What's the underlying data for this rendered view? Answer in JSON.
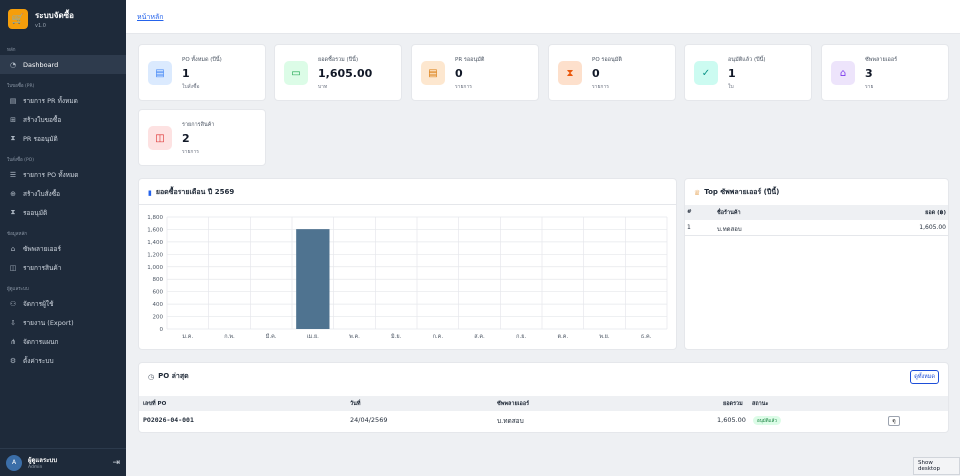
{
  "app": {
    "title": "ระบบจัดซื้อ",
    "version": "v1.0"
  },
  "sidebar": {
    "sections": [
      {
        "label": "หลัก",
        "items": [
          {
            "label": "Dashboard",
            "icon": "dashboard-icon"
          }
        ]
      },
      {
        "label": "ใบขอซื้อ (PR)",
        "items": [
          {
            "label": "รายการ PR ทั้งหมด",
            "icon": "document-icon"
          },
          {
            "label": "สร้างใบขอซื้อ",
            "icon": "plus-square-icon"
          },
          {
            "label": "PR รออนุมัติ",
            "icon": "hourglass-icon"
          }
        ]
      },
      {
        "label": "ใบสั่งซื้อ (PO)",
        "items": [
          {
            "label": "รายการ PO ทั้งหมด",
            "icon": "list-icon"
          },
          {
            "label": "สร้างใบสั่งซื้อ",
            "icon": "plus-circle-icon"
          },
          {
            "label": "รออนุมัติ",
            "icon": "hourglass-icon"
          }
        ]
      },
      {
        "label": "ข้อมูลหลัก",
        "items": [
          {
            "label": "ซัพพลายเออร์",
            "icon": "store-icon"
          },
          {
            "label": "รายการสินค้า",
            "icon": "box-icon"
          }
        ]
      },
      {
        "label": "ผู้ดูแลระบบ",
        "items": [
          {
            "label": "จัดการผู้ใช้",
            "icon": "users-icon"
          },
          {
            "label": "รายงาน (Export)",
            "icon": "download-icon"
          },
          {
            "label": "จัดการแผนก",
            "icon": "sitemap-icon"
          },
          {
            "label": "ตั้งค่าระบบ",
            "icon": "gear-icon"
          }
        ]
      }
    ],
    "user": {
      "initial": "A",
      "name": "ผู้ดูแลระบบ",
      "role": "Admin"
    }
  },
  "breadcrumb": {
    "home": "หน้าหลัก"
  },
  "stats": [
    {
      "label": "PO ทั้งหมด (ปีนี้)",
      "value": "1",
      "unit": "ใบสั่งซื้อ",
      "icon": "document-icon",
      "color": "#3b82f6",
      "bg": "#dbeafe"
    },
    {
      "label": "ยอดซื้อรวม (ปีนี้)",
      "value": "1,605.00",
      "unit": "บาท",
      "icon": "cash-icon",
      "color": "#16a34a",
      "bg": "#dcfce7"
    },
    {
      "label": "PR รออนุมัติ",
      "value": "0",
      "unit": "รายการ",
      "icon": "document-icon",
      "color": "#d97706",
      "bg": "#fde7cf"
    },
    {
      "label": "PO รออนุมัติ",
      "value": "0",
      "unit": "รายการ",
      "icon": "hourglass-icon",
      "color": "#ea580c",
      "bg": "#fde0cc"
    },
    {
      "label": "อนุมัติแล้ว (ปีนี้)",
      "value": "1",
      "unit": "ใบ",
      "icon": "check-circle-icon",
      "color": "#0d9488",
      "bg": "#ccfbf1"
    },
    {
      "label": "ซัพพลายเออร์",
      "value": "3",
      "unit": "ราย",
      "icon": "store-icon",
      "color": "#7c3aed",
      "bg": "#ede4fb"
    },
    {
      "label": "รายการสินค้า",
      "value": "2",
      "unit": "รายการ",
      "icon": "box-icon",
      "color": "#dc2626",
      "bg": "#fde2e2"
    }
  ],
  "monthly_chart": {
    "title": "ยอดซื้อรายเดือน ปี 2569",
    "chart_data": {
      "type": "bar",
      "categories": [
        "ม.ค.",
        "ก.พ.",
        "มี.ค.",
        "เม.ย.",
        "พ.ค.",
        "มิ.ย.",
        "ก.ค.",
        "ส.ค.",
        "ก.ย.",
        "ต.ค.",
        "พ.ย.",
        "ธ.ค."
      ],
      "values": [
        0,
        0,
        0,
        1605,
        0,
        0,
        0,
        0,
        0,
        0,
        0,
        0
      ],
      "ylim": [
        0,
        1800
      ],
      "yticks": [
        "0",
        "200",
        "400",
        "600",
        "800",
        "1,000",
        "1,200",
        "1,400",
        "1,600",
        "1,800"
      ],
      "bar_color": "#4f7390",
      "grid": true
    }
  },
  "top_suppliers": {
    "title": "Top ซัพพลายเออร์ (ปีนี้)",
    "headers": {
      "num": "#",
      "name": "ชื่อร้านค้า",
      "amount": "ยอด (฿)"
    },
    "rows": [
      {
        "num": "1",
        "name": "บ.ทดสอบ",
        "amount": "1,605.00"
      }
    ]
  },
  "recent_po": {
    "title": "PO ล่าสุด",
    "view_all": "ดูทั้งหมด",
    "headers": {
      "po_no": "เลขที่ PO",
      "date": "วันที่",
      "supplier": "ซัพพลายเออร์",
      "total": "ยอดรวม",
      "status": "สถานะ"
    },
    "rows": [
      {
        "po_no": "PO2026-04-001",
        "date": "24/04/2569",
        "supplier": "บ.ทดสอบ",
        "total": "1,605.00",
        "status": "อนุมัติแล้ว",
        "action": "ดู"
      }
    ]
  },
  "tooltip": "Show desktop"
}
